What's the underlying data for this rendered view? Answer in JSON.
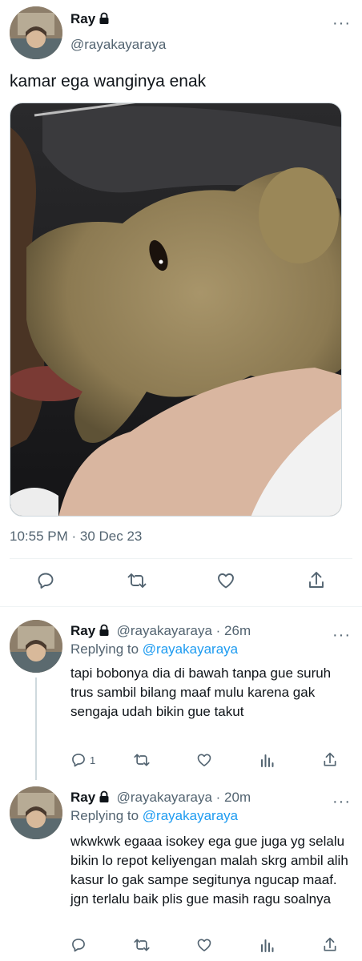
{
  "main_tweet": {
    "author_name": "Ray",
    "author_handle": "@rayakayaraya",
    "text": "kamar ega wanginya enak",
    "timestamp": "10:55 PM · 30 Dec 23",
    "media_description": "photo-teddy-bear"
  },
  "replies": [
    {
      "author_name": "Ray",
      "handle_time": "@rayakayaraya · 26m",
      "replying_label": "Replying to",
      "replying_to": "@rayakayaraya",
      "text": "tapi bobonya dia di bawah tanpa gue suruh trus sambil bilang maaf mulu karena gak sengaja udah bikin gue takut",
      "reply_count": "1"
    },
    {
      "author_name": "Ray",
      "handle_time": "@rayakayaraya · 20m",
      "replying_label": "Replying to",
      "replying_to": "@rayakayaraya",
      "text": "wkwkwk egaaa isokey ega gue juga yg selalu bikin lo repot keliyengan malah skrg ambil alih kasur lo gak sampe segitunya ngucap maaf. jgn terlalu baik plis gue masih ragu soalnya"
    }
  ],
  "more_label": "···",
  "colors": {
    "accent": "#1d9bf0",
    "secondary_text": "#536471"
  }
}
